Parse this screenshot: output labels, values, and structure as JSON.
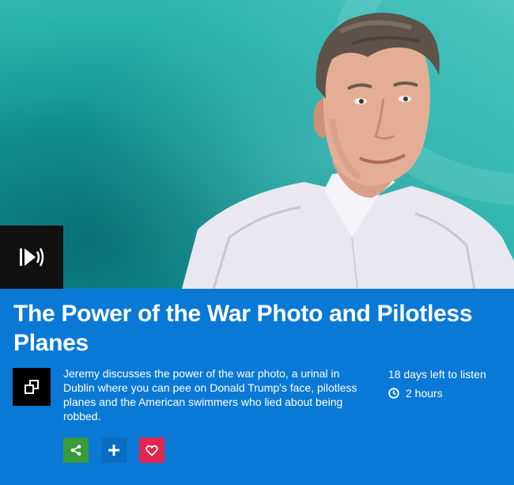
{
  "programme": {
    "title": "The Power of the War Photo and Pilotless Planes",
    "description": "Jeremy discusses the power of the war photo, a urinal in Dublin where you can pee on Donald Trump's face, pilotless planes and the American swimmers who lied about being robbed.",
    "availability": "18 days left to listen",
    "duration": "2 hours"
  },
  "icons": {
    "hero_badge": "audio-play-icon",
    "brand": "network-logo-icon",
    "clock": "clock-icon",
    "share": "share-icon",
    "add": "plus-icon",
    "favourite": "heart-icon"
  },
  "colors": {
    "panel": "#0a79d6",
    "share": "#3a9b3a",
    "add": "#0a6cc2",
    "favourite": "#e0264f"
  }
}
